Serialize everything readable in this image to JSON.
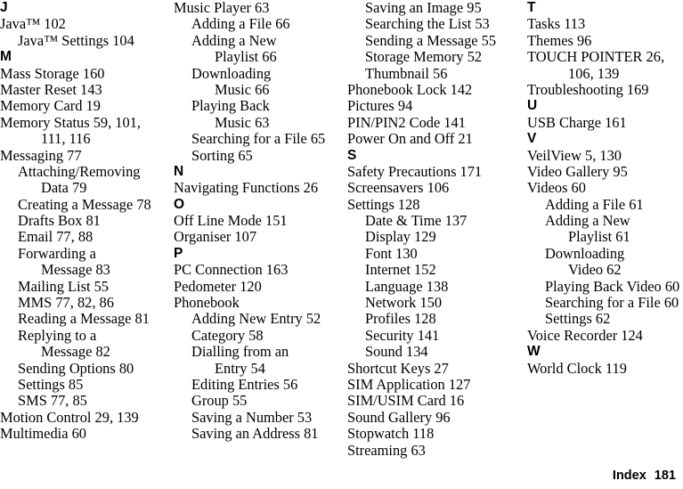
{
  "document": {
    "kind": "index-page",
    "footer": {
      "label": "Index",
      "page_number": "181"
    }
  },
  "columns": [
    {
      "name": "column-1",
      "lines": [
        {
          "type": "letter",
          "level": 0,
          "text": "J"
        },
        {
          "type": "entry",
          "level": 0,
          "text": "Java™ 102"
        },
        {
          "type": "entry",
          "level": 1,
          "text": "Java™ Settings 104"
        },
        {
          "type": "letter",
          "level": 0,
          "text": "M"
        },
        {
          "type": "entry",
          "level": 0,
          "text": "Mass Storage 160"
        },
        {
          "type": "entry",
          "level": 0,
          "text": "Master Reset 143"
        },
        {
          "type": "entry",
          "level": 0,
          "text": "Memory Card 19"
        },
        {
          "type": "entry",
          "level": 0,
          "text": "Memory Status 59, 101,"
        },
        {
          "type": "entry",
          "level": 2,
          "text": "111, 116"
        },
        {
          "type": "entry",
          "level": 0,
          "text": "Messaging 77"
        },
        {
          "type": "entry",
          "level": 1,
          "text": "Attaching/Removing"
        },
        {
          "type": "entry",
          "level": 2,
          "text": "Data 79"
        },
        {
          "type": "entry",
          "level": 1,
          "text": "Creating a Message 78"
        },
        {
          "type": "entry",
          "level": 1,
          "text": "Drafts Box 81"
        },
        {
          "type": "entry",
          "level": 1,
          "text": "Email 77, 88"
        },
        {
          "type": "entry",
          "level": 1,
          "text": "Forwarding a"
        },
        {
          "type": "entry",
          "level": 2,
          "text": "Message 83"
        },
        {
          "type": "entry",
          "level": 1,
          "text": "Mailing List 55"
        },
        {
          "type": "entry",
          "level": 1,
          "text": "MMS 77, 82, 86"
        },
        {
          "type": "entry",
          "level": 1,
          "text": "Reading a Message 81"
        },
        {
          "type": "entry",
          "level": 1,
          "text": "Replying to a"
        },
        {
          "type": "entry",
          "level": 2,
          "text": "Message 82"
        },
        {
          "type": "entry",
          "level": 1,
          "text": "Sending Options 80"
        },
        {
          "type": "entry",
          "level": 1,
          "text": "Settings 85"
        },
        {
          "type": "entry",
          "level": 1,
          "text": "SMS 77, 85"
        },
        {
          "type": "entry",
          "level": 0,
          "text": "Motion Control 29, 139"
        },
        {
          "type": "entry",
          "level": 0,
          "text": "Multimedia 60"
        }
      ]
    },
    {
      "name": "column-2",
      "lines": [
        {
          "type": "entry",
          "level": 0,
          "text": "Music Player 63"
        },
        {
          "type": "entry",
          "level": 1,
          "text": "Adding a File 66"
        },
        {
          "type": "entry",
          "level": 1,
          "text": "Adding a New"
        },
        {
          "type": "entry",
          "level": 2,
          "text": "Playlist 66"
        },
        {
          "type": "entry",
          "level": 1,
          "text": "Downloading"
        },
        {
          "type": "entry",
          "level": 2,
          "text": "Music 66"
        },
        {
          "type": "entry",
          "level": 1,
          "text": "Playing Back"
        },
        {
          "type": "entry",
          "level": 2,
          "text": "Music 63"
        },
        {
          "type": "entry",
          "level": 1,
          "text": "Searching for a File 65"
        },
        {
          "type": "entry",
          "level": 1,
          "text": "Sorting 65"
        },
        {
          "type": "letter",
          "level": 0,
          "text": "N"
        },
        {
          "type": "entry",
          "level": 0,
          "text": "Navigating Functions 26"
        },
        {
          "type": "letter",
          "level": 0,
          "text": "O"
        },
        {
          "type": "entry",
          "level": 0,
          "text": "Off Line Mode 151"
        },
        {
          "type": "entry",
          "level": 0,
          "text": "Organiser 107"
        },
        {
          "type": "letter",
          "level": 0,
          "text": "P"
        },
        {
          "type": "entry",
          "level": 0,
          "text": "PC Connection 163"
        },
        {
          "type": "entry",
          "level": 0,
          "text": "Pedometer 120"
        },
        {
          "type": "entry",
          "level": 0,
          "text": "Phonebook"
        },
        {
          "type": "entry",
          "level": 1,
          "text": "Adding New Entry 52"
        },
        {
          "type": "entry",
          "level": 1,
          "text": "Category 58"
        },
        {
          "type": "entry",
          "level": 1,
          "text": "Dialling from an"
        },
        {
          "type": "entry",
          "level": 2,
          "text": "Entry 54"
        },
        {
          "type": "entry",
          "level": 1,
          "text": "Editing Entries 56"
        },
        {
          "type": "entry",
          "level": 1,
          "text": "Group 55"
        },
        {
          "type": "entry",
          "level": 1,
          "text": "Saving a Number 53"
        },
        {
          "type": "entry",
          "level": 1,
          "text": "Saving an Address 81"
        }
      ]
    },
    {
      "name": "column-3",
      "lines": [
        {
          "type": "entry",
          "level": 1,
          "text": "Saving an Image 95"
        },
        {
          "type": "entry",
          "level": 1,
          "text": "Searching the List 53"
        },
        {
          "type": "entry",
          "level": 1,
          "text": "Sending a Message 55"
        },
        {
          "type": "entry",
          "level": 1,
          "text": "Storage Memory 52"
        },
        {
          "type": "entry",
          "level": 1,
          "text": "Thumbnail 56"
        },
        {
          "type": "entry",
          "level": 0,
          "text": "Phonebook Lock 142"
        },
        {
          "type": "entry",
          "level": 0,
          "text": "Pictures 94"
        },
        {
          "type": "entry",
          "level": 0,
          "text": "PIN/PIN2 Code 141"
        },
        {
          "type": "entry",
          "level": 0,
          "text": "Power On and Off 21"
        },
        {
          "type": "letter",
          "level": 0,
          "text": "S"
        },
        {
          "type": "entry",
          "level": 0,
          "text": "Safety Precautions 171"
        },
        {
          "type": "entry",
          "level": 0,
          "text": "Screensavers 106"
        },
        {
          "type": "entry",
          "level": 0,
          "text": "Settings 128"
        },
        {
          "type": "entry",
          "level": 1,
          "text": "Date & Time 137"
        },
        {
          "type": "entry",
          "level": 1,
          "text": "Display 129"
        },
        {
          "type": "entry",
          "level": 1,
          "text": "Font 130"
        },
        {
          "type": "entry",
          "level": 1,
          "text": "Internet 152"
        },
        {
          "type": "entry",
          "level": 1,
          "text": "Language 138"
        },
        {
          "type": "entry",
          "level": 1,
          "text": "Network 150"
        },
        {
          "type": "entry",
          "level": 1,
          "text": "Profiles 128"
        },
        {
          "type": "entry",
          "level": 1,
          "text": "Security 141"
        },
        {
          "type": "entry",
          "level": 1,
          "text": "Sound 134"
        },
        {
          "type": "entry",
          "level": 0,
          "text": "Shortcut Keys 27"
        },
        {
          "type": "entry",
          "level": 0,
          "text": "SIM Application 127"
        },
        {
          "type": "entry",
          "level": 0,
          "text": "SIM/USIM Card 16"
        },
        {
          "type": "entry",
          "level": 0,
          "text": "Sound Gallery 96"
        },
        {
          "type": "entry",
          "level": 0,
          "text": "Stopwatch 118"
        },
        {
          "type": "entry",
          "level": 0,
          "text": "Streaming 63"
        }
      ]
    },
    {
      "name": "column-4",
      "lines": [
        {
          "type": "letter",
          "level": 0,
          "text": "T"
        },
        {
          "type": "entry",
          "level": 0,
          "text": "Tasks 113"
        },
        {
          "type": "entry",
          "level": 0,
          "text": "Themes 96"
        },
        {
          "type": "entry",
          "level": 0,
          "text": "TOUCH POINTER 26,"
        },
        {
          "type": "entry",
          "level": 2,
          "text": "106, 139"
        },
        {
          "type": "entry",
          "level": 0,
          "text": "Troubleshooting 169"
        },
        {
          "type": "letter",
          "level": 0,
          "text": "U"
        },
        {
          "type": "entry",
          "level": 0,
          "text": "USB Charge 161"
        },
        {
          "type": "letter",
          "level": 0,
          "text": "V"
        },
        {
          "type": "entry",
          "level": 0,
          "text": "VeilView 5, 130"
        },
        {
          "type": "entry",
          "level": 0,
          "text": "Video Gallery 95"
        },
        {
          "type": "entry",
          "level": 0,
          "text": "Videos 60"
        },
        {
          "type": "entry",
          "level": 1,
          "text": "Adding a File 61"
        },
        {
          "type": "entry",
          "level": 1,
          "text": "Adding a New"
        },
        {
          "type": "entry",
          "level": 2,
          "text": "Playlist 61"
        },
        {
          "type": "entry",
          "level": 1,
          "text": "Downloading"
        },
        {
          "type": "entry",
          "level": 2,
          "text": "Video 62"
        },
        {
          "type": "entry",
          "level": 1,
          "text": "Playing Back Video 60"
        },
        {
          "type": "entry",
          "level": 1,
          "text": "Searching for a File 60"
        },
        {
          "type": "entry",
          "level": 1,
          "text": "Settings 62"
        },
        {
          "type": "entry",
          "level": 0,
          "text": "Voice Recorder 124"
        },
        {
          "type": "letter",
          "level": 0,
          "text": "W"
        },
        {
          "type": "entry",
          "level": 0,
          "text": "World Clock 119"
        }
      ]
    }
  ]
}
